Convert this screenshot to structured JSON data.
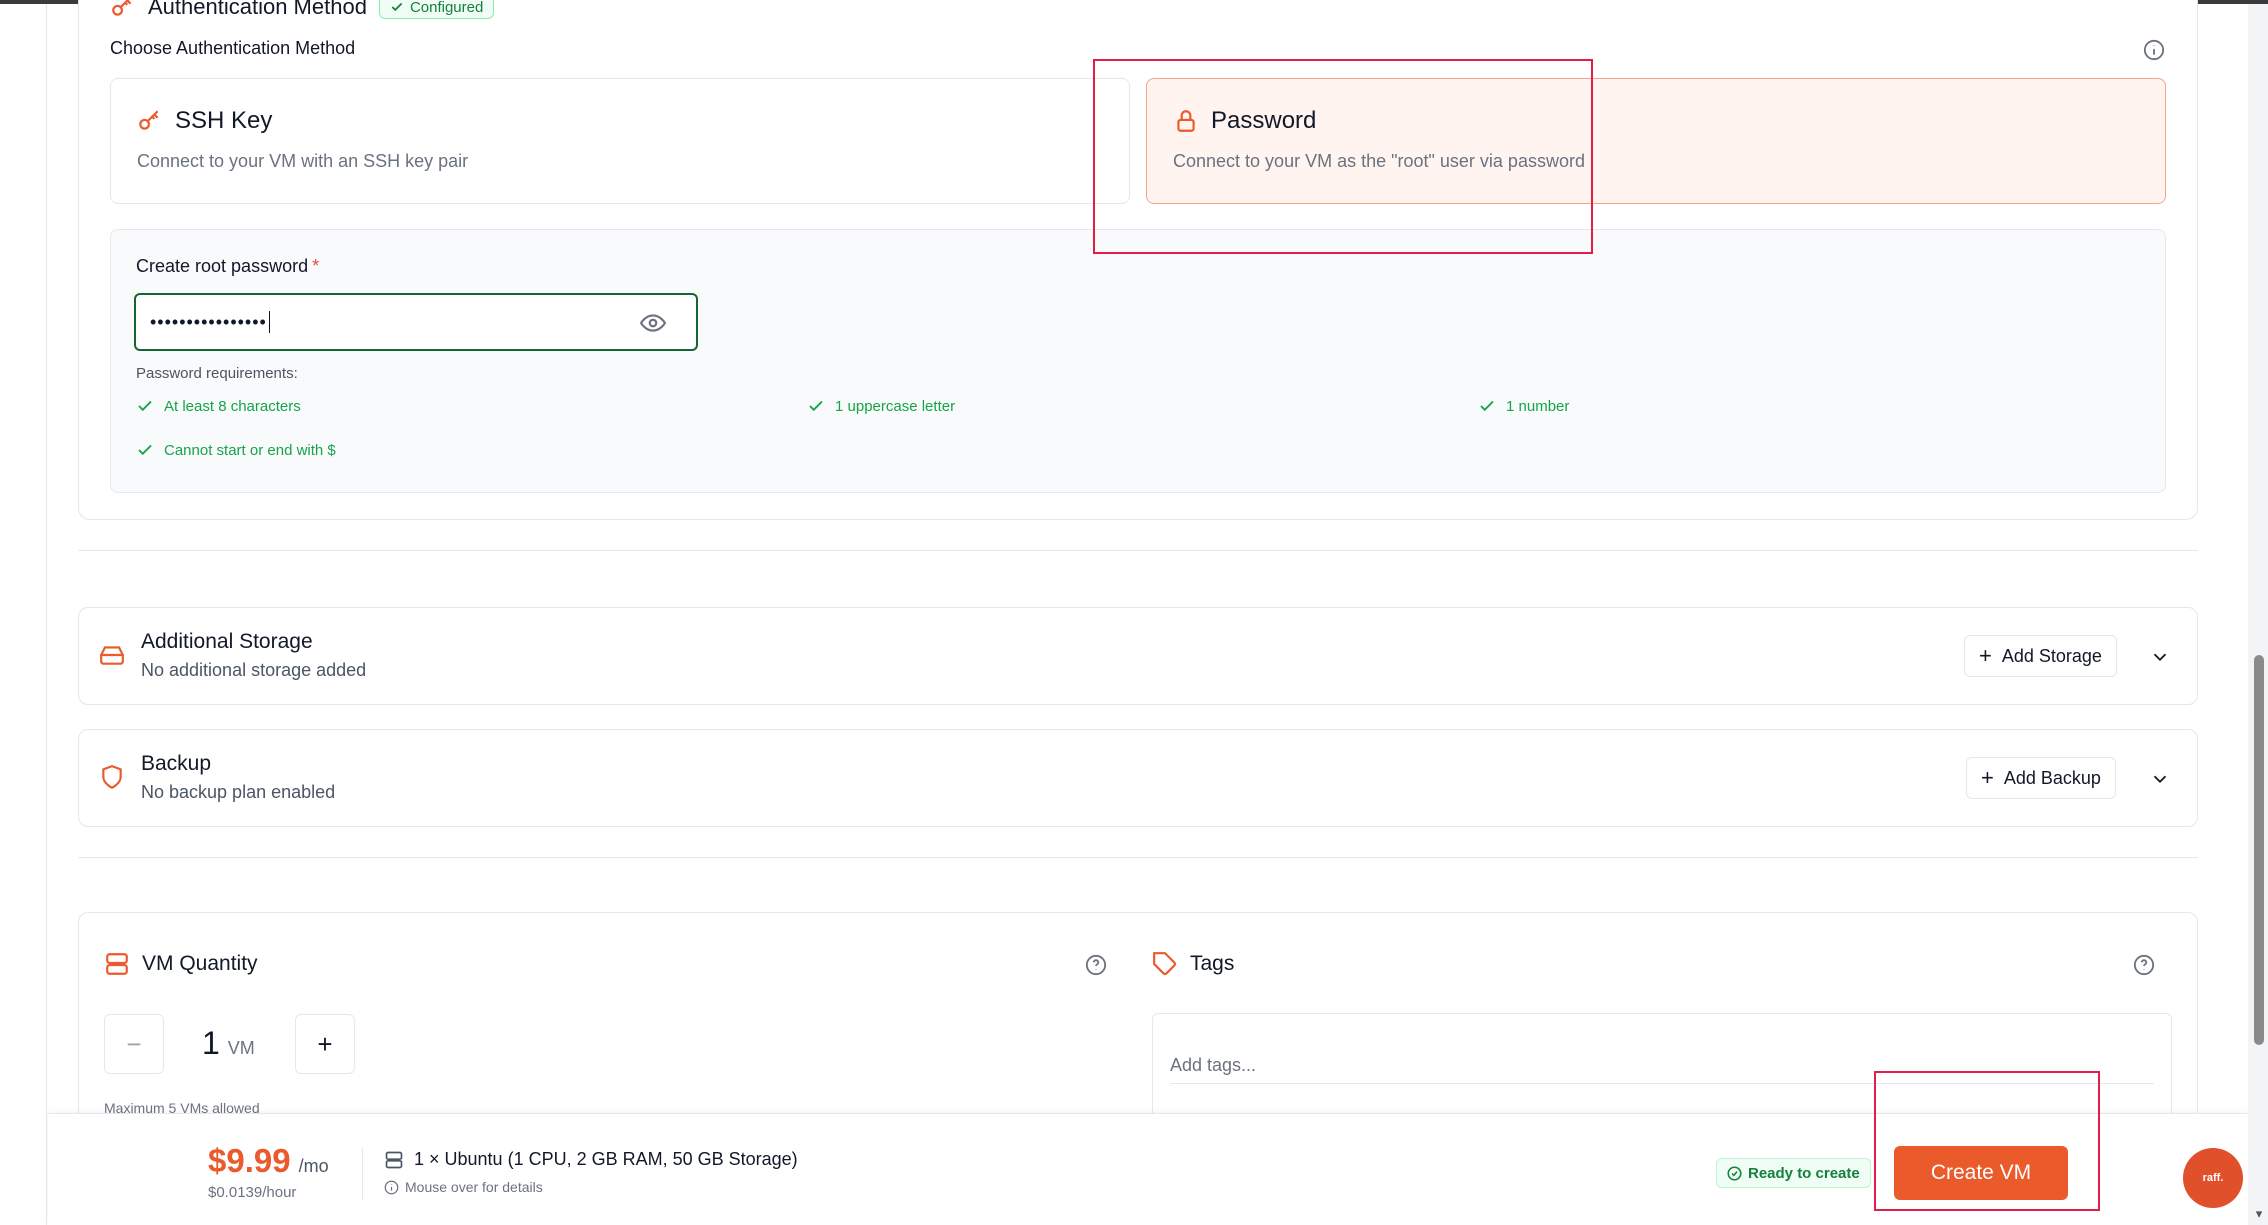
{
  "auth": {
    "title": "Authentication Method",
    "badge": "Configured",
    "choose_label": "Choose Authentication Method",
    "options": [
      {
        "name": "SSH Key",
        "desc": "Connect to your VM with an SSH key pair"
      },
      {
        "name": "Password",
        "desc": "Connect to your VM as the \"root\" user via password"
      }
    ],
    "selected": "Password",
    "password": {
      "label": "Create root password",
      "required_mark": "*",
      "value": "••••••••••••••••",
      "requirements_title": "Password requirements:",
      "requirements": [
        "At least 8 characters",
        "1 uppercase letter",
        "1 number",
        "Cannot start or end with $"
      ]
    }
  },
  "storage": {
    "title": "Additional Storage",
    "subtitle": "No additional storage added",
    "button": "Add Storage"
  },
  "backup": {
    "title": "Backup",
    "subtitle": "No backup plan enabled",
    "button": "Add Backup"
  },
  "quantity": {
    "title": "VM Quantity",
    "minus": "−",
    "plus": "+",
    "value": "1",
    "unit": "VM",
    "max_note": "Maximum 5 VMs allowed"
  },
  "tags": {
    "title": "Tags",
    "placeholder": "Add tags..."
  },
  "footer": {
    "price": "$9.99",
    "per": "/mo",
    "hourly": "$0.0139/hour",
    "spec": "1 × Ubuntu (1 CPU, 2 GB RAM, 50 GB Storage)",
    "hint": "Mouse over for details",
    "status": "Ready to create",
    "create_button": "Create VM",
    "fab_label": "raff."
  },
  "colors": {
    "accent": "#ea5a2b",
    "success": "#16a34a",
    "selected_bg": "#fff4f0"
  }
}
